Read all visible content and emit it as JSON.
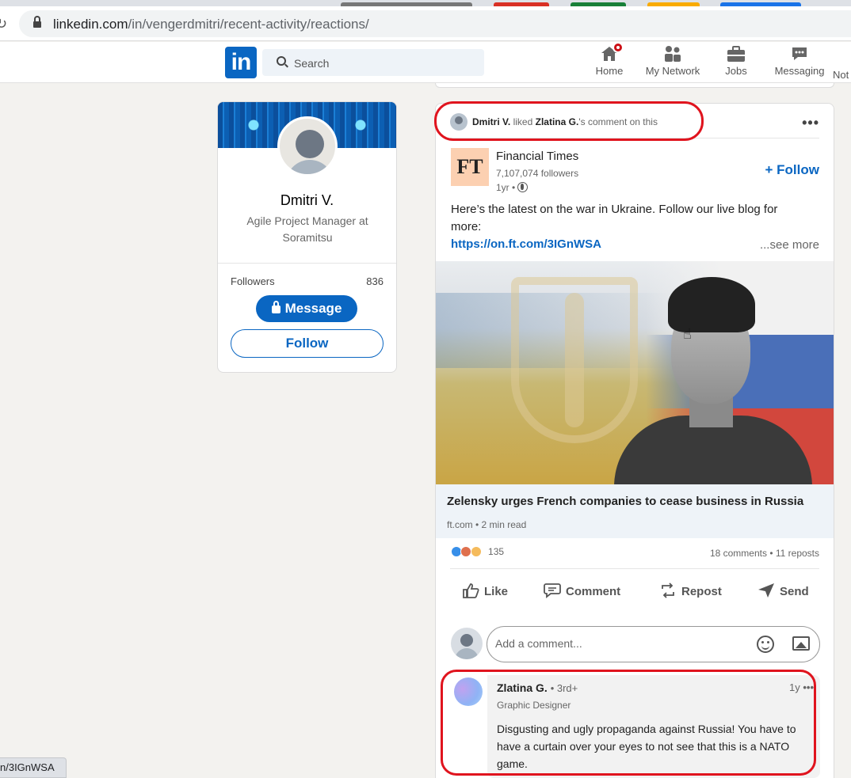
{
  "browser": {
    "url_domain": "linkedin.com",
    "url_path": "/in/vengerdmitri/recent-activity/reactions/",
    "status_text": "n/3IGnWSA"
  },
  "nav": {
    "search_placeholder": "Search",
    "items": [
      {
        "label": "Home",
        "icon": "home-icon"
      },
      {
        "label": "My Network",
        "icon": "network-icon"
      },
      {
        "label": "Jobs",
        "icon": "briefcase-icon"
      },
      {
        "label": "Messaging",
        "icon": "messaging-icon"
      },
      {
        "label": "Not"
      }
    ],
    "logo_text": "in"
  },
  "profile": {
    "name": "Dmitri V.",
    "headline": "Agile Project Manager at Soramitsu",
    "followers_label": "Followers",
    "followers_count": "836",
    "message_label": "Message",
    "follow_label": "Follow"
  },
  "post": {
    "activity_actor": "Dmitri V.",
    "activity_verb": "liked",
    "activity_target": "Zlatina G.",
    "activity_suffix": "'s comment on this",
    "org_logo_text": "FT",
    "org_name": "Financial Times",
    "org_followers": "7,107,074 followers",
    "org_time": "1yr •",
    "follow_label": "+ Follow",
    "text": "Here’s the latest on the war in Ukraine. Follow our live blog for more:",
    "link": "https://on.ft.com/3IGnWSA",
    "see_more": "...see more",
    "article_title": "Zelensky urges French companies to cease business in Russia",
    "article_source": "ft.com • 2 min read",
    "reaction_count": "135",
    "stats": "18 comments • 11 reposts",
    "actions": {
      "like": "Like",
      "comment": "Comment",
      "repost": "Repost",
      "send": "Send"
    },
    "comment_placeholder": "Add a comment..."
  },
  "comment": {
    "author": "Zlatina G.",
    "degree": "• 3rd+",
    "title": "Graphic Designer",
    "time": "1y",
    "text": "Disgusting and ugly propaganda against Russia! You have to have a curtain over your eyes to not see that this is a NATO game."
  },
  "colors": {
    "brand": "#0a66c2",
    "annotation": "#e0141e",
    "notification": "#cc1016"
  }
}
